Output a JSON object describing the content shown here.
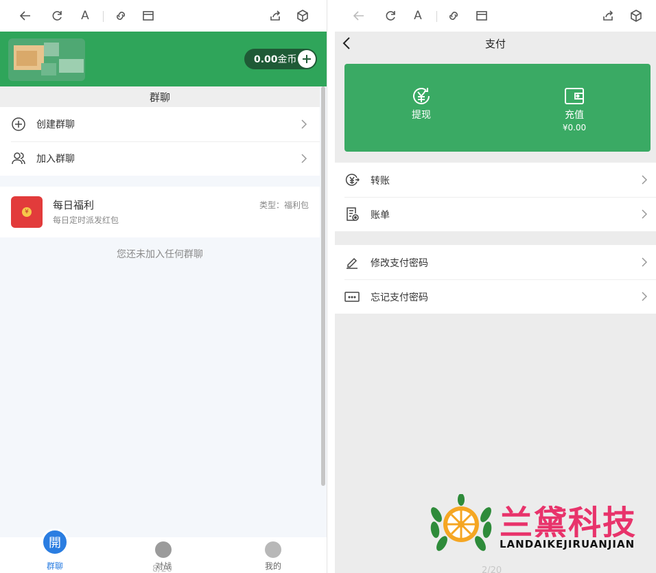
{
  "left": {
    "coins": {
      "amount": "0.00",
      "unit": "金币"
    },
    "section_title": "群聊",
    "menu": [
      {
        "label": "创建群聊",
        "icon": "plus-circle-icon"
      },
      {
        "label": "加入群聊",
        "icon": "users-icon"
      }
    ],
    "welfare": {
      "title": "每日福利",
      "subtitle": "每日定时派发红包",
      "type": "类型：福利包"
    },
    "empty_text": "您还未加入任何群聊",
    "tabs": [
      {
        "label": "群聊",
        "active": true
      },
      {
        "label": "对战",
        "active": false
      },
      {
        "label": "我的",
        "active": false
      }
    ],
    "tab_badge": "開",
    "ghost_text": "8/20"
  },
  "right": {
    "nav_title": "支付",
    "withdraw": {
      "label": "提现"
    },
    "recharge": {
      "label": "充值",
      "amount": "¥0.00"
    },
    "rows_a": [
      {
        "label": "转账",
        "icon": "transfer-icon"
      },
      {
        "label": "账单",
        "icon": "bill-icon"
      }
    ],
    "rows_b": [
      {
        "label": "修改支付密码",
        "icon": "pen-icon"
      },
      {
        "label": "忘记支付密码",
        "icon": "keyboard-icon"
      }
    ],
    "ghost_text": "2/20"
  },
  "watermark": {
    "brand": "兰黛科技",
    "sub": "LANDAIKEJIRUANJIAN"
  },
  "colors": {
    "green": "#2fa55a",
    "card_green": "#3aaa64",
    "brand_pink": "#e8336b",
    "tab_blue": "#2a7de1"
  }
}
